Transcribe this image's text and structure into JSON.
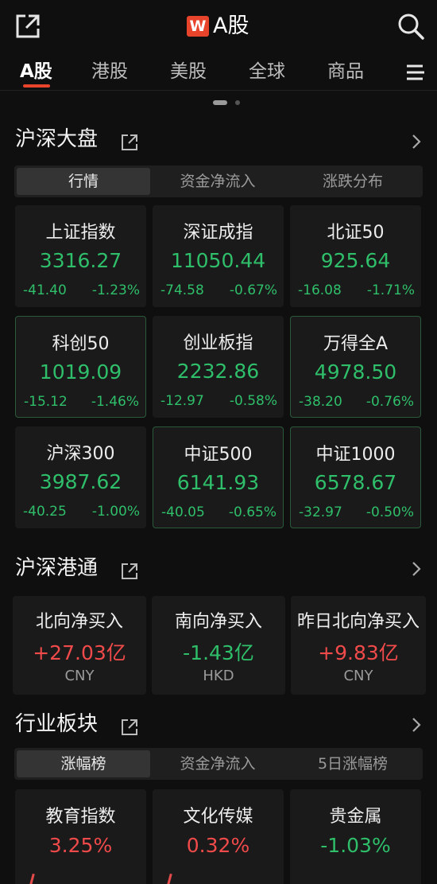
{
  "header": {
    "logo_letter": "W",
    "title": "A股"
  },
  "tabs": [
    "A股",
    "港股",
    "美股",
    "全球",
    "商品"
  ],
  "colors": {
    "up": "#f04a4a",
    "down": "#2fbf6a",
    "accent": "#e8432b"
  },
  "icons": [
    "share-icon",
    "search-icon",
    "menu-icon",
    "external-link-icon",
    "chevron-right-icon"
  ],
  "market": {
    "title": "沪深大盘",
    "segments": [
      "行情",
      "资金净流入",
      "涨跌分布"
    ],
    "indices": [
      {
        "name": "上证指数",
        "value": "3316.27",
        "change": "-41.40",
        "pct": "-1.23%"
      },
      {
        "name": "深证成指",
        "value": "11050.44",
        "change": "-74.58",
        "pct": "-0.67%"
      },
      {
        "name": "北证50",
        "value": "925.64",
        "change": "-16.08",
        "pct": "-1.71%"
      },
      {
        "name": "科创50",
        "value": "1019.09",
        "change": "-15.12",
        "pct": "-1.46%"
      },
      {
        "name": "创业板指",
        "value": "2232.86",
        "change": "-12.97",
        "pct": "-0.58%"
      },
      {
        "name": "万得全A",
        "value": "4978.50",
        "change": "-38.20",
        "pct": "-0.76%"
      },
      {
        "name": "沪深300",
        "value": "3987.62",
        "change": "-40.25",
        "pct": "-1.00%"
      },
      {
        "name": "中证500",
        "value": "6141.93",
        "change": "-40.05",
        "pct": "-0.65%"
      },
      {
        "name": "中证1000",
        "value": "6578.67",
        "change": "-32.97",
        "pct": "-0.50%"
      }
    ]
  },
  "connect": {
    "title": "沪深港通",
    "items": [
      {
        "name": "北向净买入",
        "value": "+27.03亿",
        "currency": "CNY"
      },
      {
        "name": "南向净买入",
        "value": "-1.43亿",
        "currency": "HKD"
      },
      {
        "name": "昨日北向净买入",
        "value": "+9.83亿",
        "currency": "CNY"
      }
    ]
  },
  "industry": {
    "title": "行业板块",
    "segments": [
      "涨幅榜",
      "资金净流入",
      "5日涨幅榜"
    ],
    "items": [
      {
        "name": "教育指数",
        "value": "3.25%"
      },
      {
        "name": "文化传媒",
        "value": "0.32%"
      },
      {
        "name": "贵金属",
        "value": "-1.03%"
      }
    ]
  }
}
